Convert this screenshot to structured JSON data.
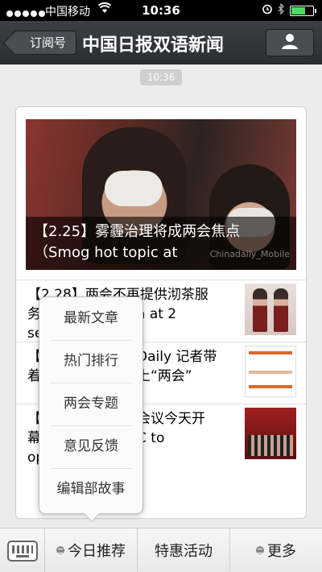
{
  "status_bar": {
    "carrier": "中国移动",
    "time": "10:36",
    "battery_level": 0.62
  },
  "nav": {
    "back_label": "订阅号",
    "title": "中国日报双语新闻",
    "profile_icon": "person-icon"
  },
  "timestamp": "10:36",
  "article": {
    "hero_caption_line1": "【2.25】雾霾治理将成两会焦点",
    "hero_caption_line2": "（Smog hot topic at",
    "hero_watermark": "Chinadaily_Mobile",
    "items": [
      {
        "line1": "【2.28】两会不再提供沏茶服",
        "line2": "务…………………a at 2",
        "line3": "se"
      },
      {
        "line1": "【…………………Daily 记者带",
        "line2": "着…………………上“两会”"
      },
      {
        "line1": "【…………………会议今天开",
        "line2": "幕…………………C to",
        "line3": "op"
      }
    ]
  },
  "popup_menu": {
    "items": [
      "最新文章",
      "热门排行",
      "两会专题",
      "意见反馈",
      "编辑部故事"
    ]
  },
  "bottom_bar": {
    "keyboard_icon": "keyboard-icon",
    "tabs": [
      "今日推荐",
      "特惠活动",
      "更多"
    ]
  }
}
